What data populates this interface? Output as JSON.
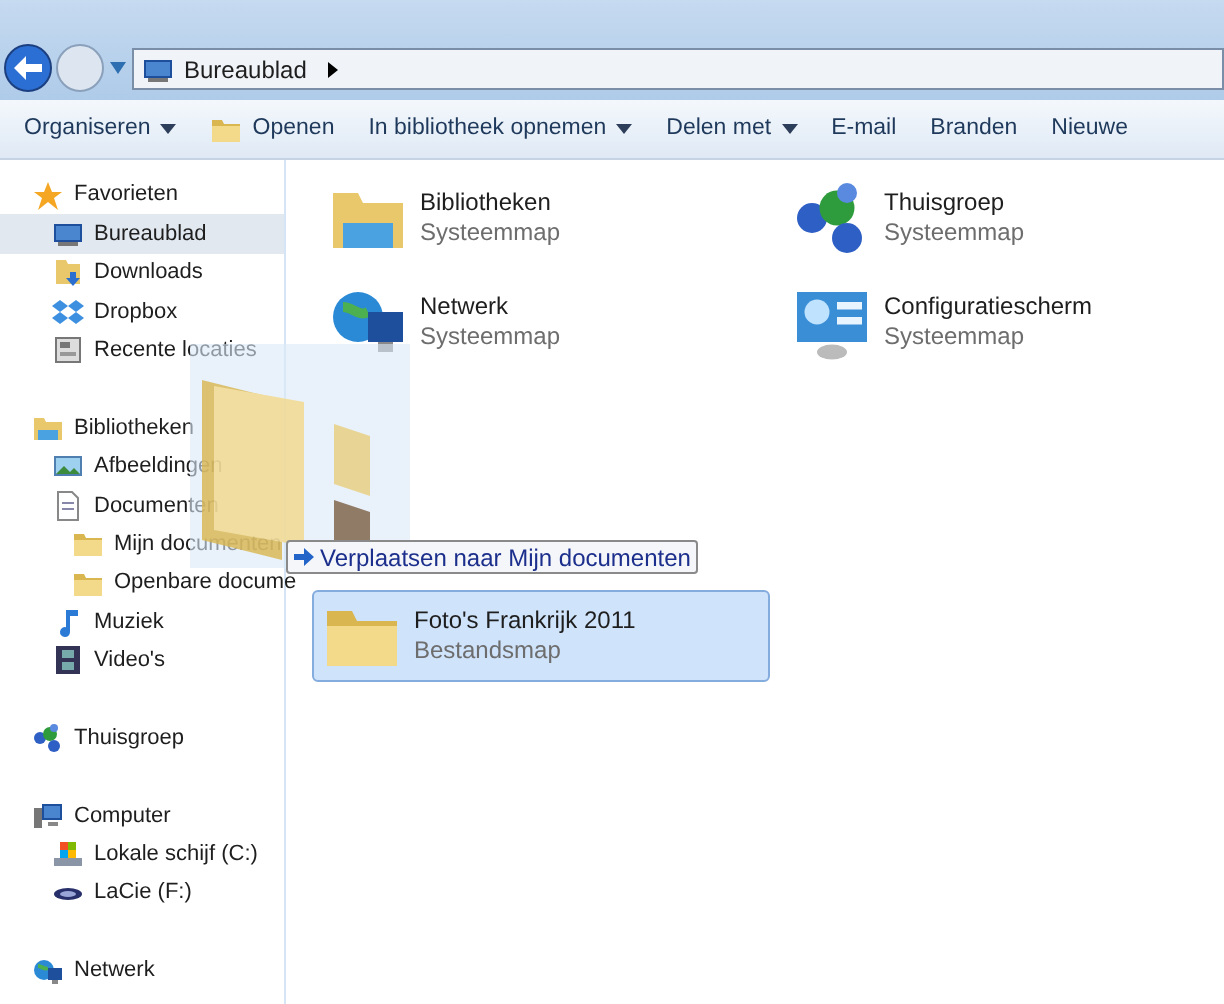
{
  "address_bar": {
    "path": [
      "Bureaublad"
    ]
  },
  "toolbar": [
    {
      "label": "Organiseren",
      "kind": "dropdown"
    },
    {
      "label": "Openen",
      "kind": "open"
    },
    {
      "label": "In bibliotheek opnemen",
      "kind": "dropdown"
    },
    {
      "label": "Delen met",
      "kind": "dropdown"
    },
    {
      "label": "E-mail",
      "kind": "action"
    },
    {
      "label": "Branden",
      "kind": "action"
    },
    {
      "label": "Nieuwe",
      "kind": "action"
    }
  ],
  "sidebar": {
    "groups": [
      {
        "label": "Favorieten",
        "kind": "star",
        "children": [
          {
            "label": "Bureaublad",
            "kind": "desktop",
            "selected": true
          },
          {
            "label": "Downloads",
            "kind": "download",
            "selected": false
          },
          {
            "label": "Dropbox",
            "kind": "dropbox",
            "selected": false
          },
          {
            "label": "Recente locaties",
            "kind": "recent",
            "selected": false
          }
        ]
      },
      {
        "label": "Bibliotheken",
        "kind": "library",
        "children": [
          {
            "label": "Afbeeldingen",
            "kind": "image",
            "selected": false
          },
          {
            "label": "Documenten",
            "kind": "document",
            "selected": false,
            "children": [
              {
                "label": "Mijn documenten",
                "kind": "folder",
                "selected": false
              },
              {
                "label": "Openbare docume",
                "kind": "folder",
                "selected": false
              }
            ]
          },
          {
            "label": "Muziek",
            "kind": "music",
            "selected": false
          },
          {
            "label": "Video's",
            "kind": "video",
            "selected": false
          }
        ]
      },
      {
        "label": "Thuisgroep",
        "kind": "homegroup"
      },
      {
        "label": "Computer",
        "kind": "computer",
        "children": [
          {
            "label": "Lokale schijf (C:)",
            "kind": "drive",
            "selected": false
          },
          {
            "label": "LaCie (F:)",
            "kind": "usb",
            "selected": false
          }
        ]
      },
      {
        "label": "Netwerk",
        "kind": "network"
      }
    ]
  },
  "items": [
    {
      "name": "Bibliotheken",
      "type": "Systeemmap",
      "kind": "library",
      "selected": false
    },
    {
      "name": "Thuisgroep",
      "type": "Systeemmap",
      "kind": "homegroup",
      "selected": false
    },
    {
      "name": "Netwerk",
      "type": "Systeemmap",
      "kind": "network",
      "selected": false
    },
    {
      "name": "Configuratiescherm",
      "type": "Systeemmap",
      "kind": "control",
      "selected": false
    },
    {
      "name": "Foto's Frankrijk 2011",
      "type": "Bestandsmap",
      "kind": "folder",
      "selected": true
    }
  ],
  "drag_tooltip": "Verplaatsen naar Mijn documenten"
}
